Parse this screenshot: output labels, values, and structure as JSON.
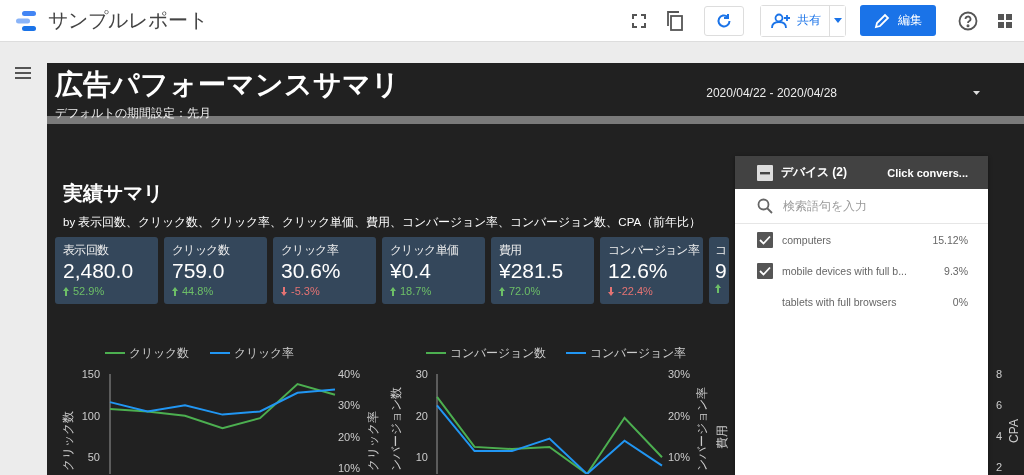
{
  "app_bar": {
    "title": "サンプルレポート",
    "share_label": "共有",
    "edit_label": "編集"
  },
  "report": {
    "title": "広告パフォーマンスサマリ",
    "subtitle": "デフォルトの期間設定：先月",
    "date_range": "2020/04/22 - 2020/04/28"
  },
  "summary": {
    "title": "実績サマリ",
    "description": "by 表示回数、クリック数、クリック率、クリック単価、費用、コンバージョン率、コンバージョン数、CPA（前年比）",
    "scorecards": [
      {
        "label": "表示回数",
        "value": "2,480.0",
        "change": "52.9%",
        "increase": true
      },
      {
        "label": "クリック数",
        "value": "759.0",
        "change": "44.8%",
        "increase": true
      },
      {
        "label": "クリック率",
        "value": "30.6%",
        "change": "-5.3%",
        "increase": false
      },
      {
        "label": "クリック単価",
        "value": "¥0.4",
        "change": "18.7%",
        "increase": true
      },
      {
        "label": "費用",
        "value": "¥281.5",
        "change": "72.0%",
        "increase": true
      },
      {
        "label": "コンバージョン率",
        "value": "12.6%",
        "change": "-22.4%",
        "increase": false
      },
      {
        "label": "コ",
        "value": "9",
        "increase": true
      }
    ]
  },
  "charts": [
    {
      "chart_data": {
        "type": "line",
        "legend": true,
        "ylabel": "クリック数",
        "y2label": "クリック率",
        "ylim": [
          30,
          150
        ],
        "y2lim": [
          8,
          40
        ],
        "yticks": [
          50,
          100,
          150
        ],
        "y2ticks": [
          {
            "value": 10,
            "label": "10%"
          },
          {
            "value": 20,
            "label": "20%"
          },
          {
            "value": 30,
            "label": "30%"
          },
          {
            "value": 40,
            "label": "40%"
          }
        ],
        "series": [
          {
            "name": "クリック数",
            "color": "#4caf50",
            "values": [
              108,
              105,
              100,
              85,
              97,
              138,
              125
            ]
          },
          {
            "name": "クリック率",
            "color": "#2196f3",
            "axis": "y2",
            "values": [
              31,
              28,
              30,
              27,
              28,
              34,
              35
            ]
          }
        ]
      }
    },
    {
      "chart_data": {
        "type": "line",
        "legend": true,
        "ylabel": "ンバージョン数",
        "y2label": "ンバージョン率",
        "ylim": [
          6,
          30
        ],
        "y2lim": [
          6,
          30
        ],
        "yticks": [
          10,
          20,
          30
        ],
        "y2ticks": [
          {
            "value": 10,
            "label": "10%"
          },
          {
            "value": 20,
            "label": "20%"
          },
          {
            "value": 30,
            "label": "30%"
          }
        ],
        "series": [
          {
            "name": "コンバージョン数",
            "color": "#4caf50",
            "values": [
              24.5,
              12.5,
              12,
              12.5,
              6,
              19.5,
              10
            ]
          },
          {
            "name": "コンバージョン率",
            "color": "#2196f3",
            "axis": "y2",
            "values": [
              22.5,
              11.5,
              11.5,
              14.5,
              6,
              14,
              8
            ]
          }
        ]
      }
    }
  ],
  "chart_3_axes": {
    "ylabel": "費用",
    "y2label": "CPA",
    "y2ticks": [
      "8",
      "6",
      "4",
      "2"
    ]
  },
  "device_filter": {
    "title": "デバイス (2)",
    "metric": "Click convers...",
    "search_placeholder": "検索語句を入力",
    "items": [
      {
        "label": "computers",
        "value": "15.12%",
        "checked": true
      },
      {
        "label": "mobile devices with full b...",
        "value": "9.3%",
        "checked": true
      },
      {
        "label": "tablets with full browsers",
        "value": "0%",
        "checked": false
      }
    ]
  }
}
